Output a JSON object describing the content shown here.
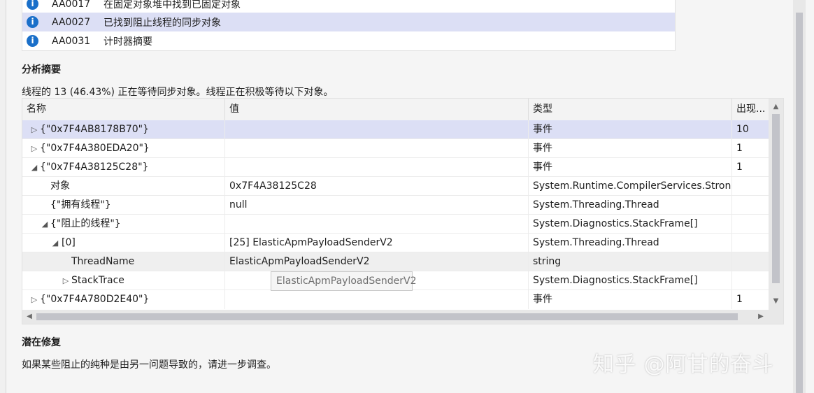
{
  "rules": [
    {
      "id": "AA0017",
      "title": "在固定对象堆中找到已固定对象",
      "selected": false
    },
    {
      "id": "AA0027",
      "title": "已找到阻止线程的同步对象",
      "selected": true
    },
    {
      "id": "AA0031",
      "title": "计时器摘要",
      "selected": false
    }
  ],
  "analysis": {
    "heading": "分析摘要",
    "summary": "线程的 13 (46.43%) 正在等待同步对象。线程正在积极等待以下对象。"
  },
  "grid": {
    "columns": {
      "name": "名称",
      "value": "值",
      "type": "类型",
      "count": "出现..."
    },
    "rows": [
      {
        "name": "{\"0x7F4AB8178B70\"}",
        "value": "",
        "type": "事件",
        "count": "10"
      },
      {
        "name": "{\"0x7F4A380EDA20\"}",
        "value": "",
        "type": "事件",
        "count": "1"
      },
      {
        "name": "{\"0x7F4A38125C28\"}",
        "value": "",
        "type": "事件",
        "count": "1"
      },
      {
        "name": "对象",
        "value": "0x7F4A38125C28",
        "type": "System.Runtime.CompilerServices.Stron...",
        "count": ""
      },
      {
        "name": "{\"拥有线程\"}",
        "value": "null",
        "type": "System.Threading.Thread",
        "count": ""
      },
      {
        "name": "{\"阻止的线程\"}",
        "value": "",
        "type": "System.Diagnostics.StackFrame[]",
        "count": ""
      },
      {
        "name": "[0]",
        "value": "[25] ElasticApmPayloadSenderV2",
        "type": "System.Threading.Thread",
        "count": ""
      },
      {
        "name": "ThreadName",
        "value": "ElasticApmPayloadSenderV2",
        "type": "string",
        "count": ""
      },
      {
        "name": "StackTrace",
        "value": "",
        "type": "System.Diagnostics.StackFrame[]",
        "count": ""
      },
      {
        "name": "{\"0x7F4A780D2E40\"}",
        "value": "",
        "type": "事件",
        "count": "1"
      }
    ]
  },
  "tooltip": "ElasticApmPayloadSenderV2",
  "fix": {
    "heading": "潜在修复",
    "text": "如果某些阻止的纯种是由另一问题导致的，请进一步调查。"
  },
  "watermark": "知乎 @阿甘的奋斗",
  "icons": {
    "rule": "info-icon",
    "collapsed": "triangle-right-icon",
    "expanded": "triangle-down-icon"
  },
  "colors": {
    "selection": "#dcdff5",
    "info_icon": "#1a6fc9"
  }
}
